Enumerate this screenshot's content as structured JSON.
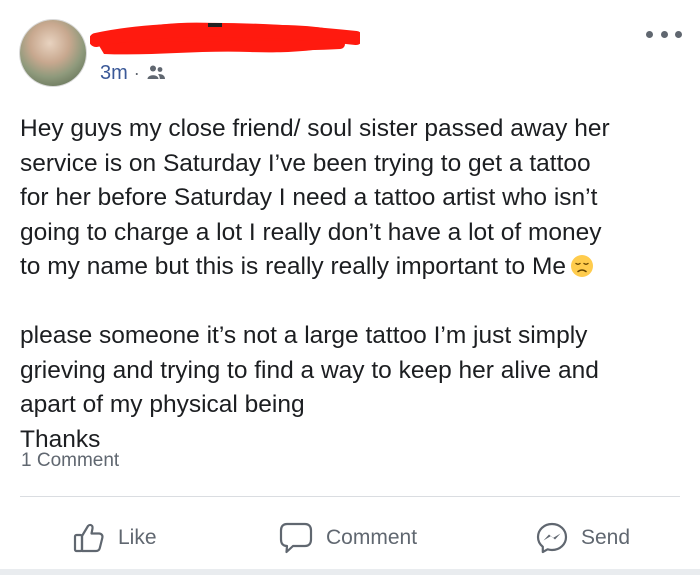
{
  "post": {
    "time": "3m",
    "separator": "·",
    "audience_icon": "friends-icon",
    "text": "Hey guys my close friend/ soul sister passed away her\nservice is on Saturday I’ve been trying to get a tattoo\nfor her before Saturday I need a tattoo artist who isn’t\ngoing to charge a lot I really don’t have a lot of money\nto my name but this is really really important to Me",
    "text_after_emoji": "please someone it’s not a large tattoo I’m just simply\ngrieving and trying to find a way to keep her alive and\napart of my physical being\nThanks",
    "emoji": "disappointed-face-emoji",
    "comment_count_label": "1 Comment"
  },
  "actions": {
    "like_label": "Like",
    "comment_label": "Comment",
    "send_label": "Send"
  },
  "colors": {
    "redaction": "#ff1a0f",
    "link_blue": "#3b5998",
    "muted": "#606770"
  }
}
